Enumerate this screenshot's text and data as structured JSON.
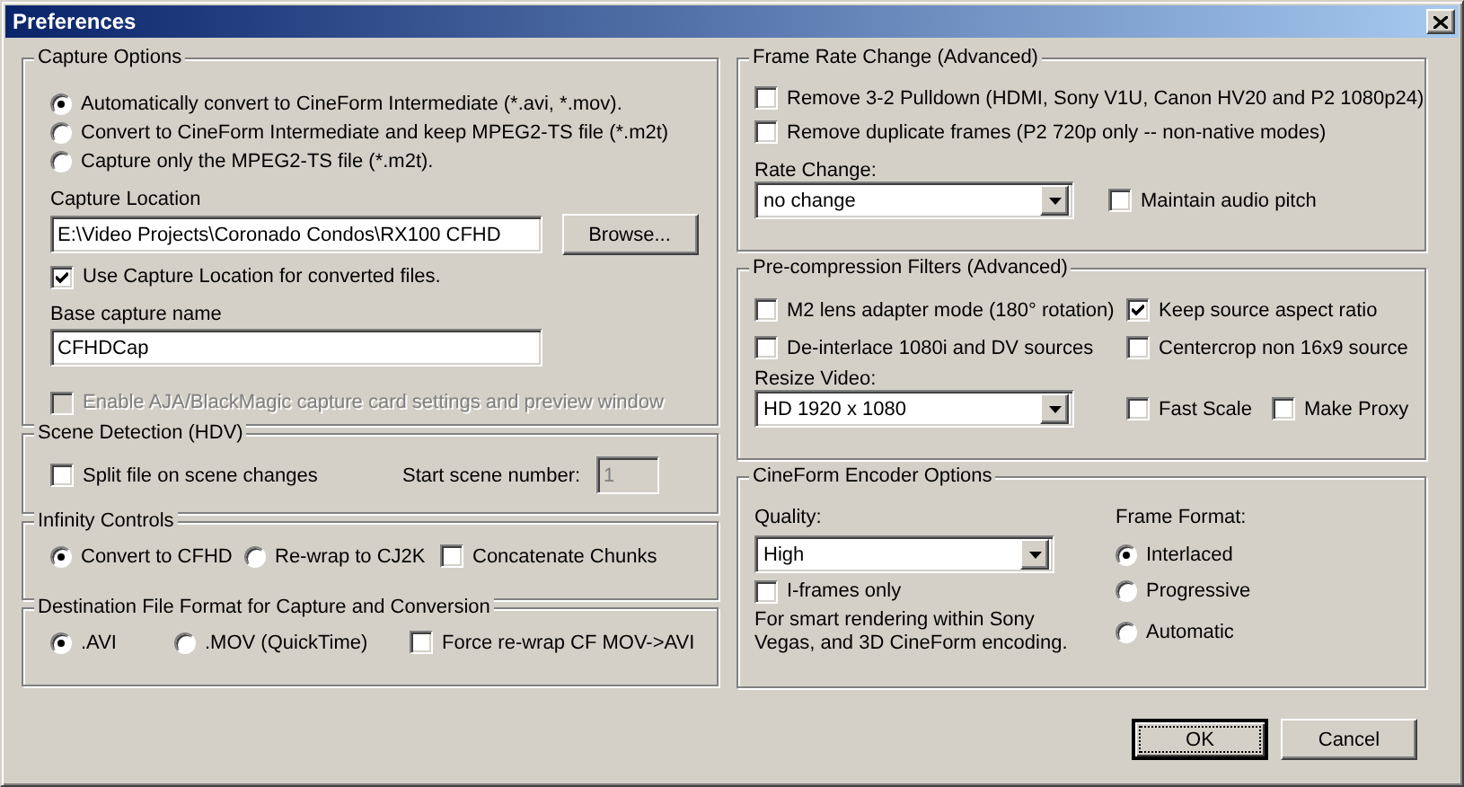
{
  "window": {
    "title": "Preferences"
  },
  "left_panel": {
    "groups": [
      {
        "title": "Capture Options",
        "rows": [
          [
            {
              "kind": "radio",
              "label": "Automatically convert to CineForm Intermediate (*.avi, *.mov).",
              "selected": true
            }
          ],
          [
            {
              "kind": "radio",
              "label": "Convert to CineForm Intermediate and keep MPEG2-TS file (*.m2t)",
              "selected": false
            }
          ],
          [
            {
              "kind": "radio",
              "label": "Capture only the MPEG2-TS file (*.m2t).",
              "selected": false
            }
          ],
          [
            {
              "kind": "label",
              "text": "Capture Location"
            }
          ],
          [
            {
              "kind": "field",
              "value": "E:\\Video Projects\\Coronado Condos\\RX100 CFHD",
              "disabled": false
            },
            {
              "kind": "button",
              "label": "Browse...",
              "default": false
            }
          ],
          [
            {
              "kind": "checkbox",
              "label": "Use Capture Location for converted files.",
              "checked": true,
              "disabled": false
            }
          ],
          [
            {
              "kind": "label",
              "text": "Base capture name"
            }
          ],
          [
            {
              "kind": "field",
              "value": "CFHDCap",
              "disabled": false
            }
          ],
          [
            {
              "kind": "checkbox",
              "label": "Enable AJA/BlackMagic capture card settings and preview window",
              "checked": false,
              "disabled": true
            }
          ]
        ]
      },
      {
        "title": "Scene Detection (HDV)",
        "rows": [
          [
            {
              "kind": "checkbox",
              "label": "Split file on scene changes",
              "checked": false,
              "disabled": false
            },
            {
              "kind": "label",
              "text": "Start scene number:"
            },
            {
              "kind": "field",
              "value": "1",
              "disabled": true
            }
          ]
        ]
      },
      {
        "title": "Infinity Controls",
        "rows": [
          [
            {
              "kind": "radio",
              "label": "Convert to CFHD",
              "selected": true
            },
            {
              "kind": "radio",
              "label": "Re-wrap to CJ2K",
              "selected": false
            },
            {
              "kind": "checkbox",
              "label": "Concatenate Chunks",
              "checked": false,
              "disabled": false
            }
          ]
        ]
      },
      {
        "title": "Destination File Format for Capture and Conversion",
        "rows": [
          [
            {
              "kind": "radio",
              "label": ".AVI",
              "selected": true
            },
            {
              "kind": "radio",
              "label": ".MOV (QuickTime)",
              "selected": false
            },
            {
              "kind": "checkbox",
              "label": "Force re-wrap CF MOV->AVI",
              "checked": false,
              "disabled": false
            }
          ]
        ]
      }
    ]
  },
  "right_panel": {
    "groups": [
      {
        "title": "Frame Rate Change (Advanced)",
        "rows": [
          [
            {
              "kind": "checkbox",
              "label": "Remove 3-2 Pulldown (HDMI, Sony V1U, Canon HV20 and P2 1080p24)",
              "checked": false,
              "disabled": false
            }
          ],
          [
            {
              "kind": "checkbox",
              "label": "Remove duplicate frames (P2 720p only -- non-native modes)",
              "checked": false,
              "disabled": false
            }
          ],
          [
            {
              "kind": "label",
              "text": "Rate Change:"
            }
          ],
          [
            {
              "kind": "combo",
              "value": "no change"
            },
            {
              "kind": "checkbox",
              "label": "Maintain audio pitch",
              "checked": false,
              "disabled": false
            }
          ]
        ]
      },
      {
        "title": "Pre-compression Filters (Advanced)",
        "rows": [
          [
            {
              "kind": "checkbox",
              "label": "M2 lens adapter mode (180° rotation)",
              "checked": false,
              "disabled": false
            },
            {
              "kind": "checkbox",
              "label": "Keep source aspect ratio",
              "checked": true,
              "disabled": false
            }
          ],
          [
            {
              "kind": "checkbox",
              "label": "De-interlace 1080i and DV sources",
              "checked": false,
              "disabled": false
            },
            {
              "kind": "checkbox",
              "label": "Centercrop non 16x9 source",
              "checked": false,
              "disabled": false
            }
          ],
          [
            {
              "kind": "label",
              "text": "Resize Video:"
            }
          ],
          [
            {
              "kind": "combo",
              "value": "HD 1920 x 1080"
            },
            {
              "kind": "checkbox",
              "label": "Fast Scale",
              "checked": false,
              "disabled": false
            },
            {
              "kind": "checkbox",
              "label": "Make Proxy",
              "checked": false,
              "disabled": false
            }
          ]
        ]
      },
      {
        "title": "CineForm Encoder Options",
        "rows": [
          [
            {
              "kind": "label",
              "text": "Quality:"
            },
            {
              "kind": "label",
              "text": "Frame Format:"
            }
          ],
          [
            {
              "kind": "combo",
              "value": "High"
            },
            {
              "kind": "radio",
              "label": "Interlaced",
              "selected": true
            }
          ],
          [
            {
              "kind": "checkbox",
              "label": "I-frames only",
              "checked": false,
              "disabled": false
            },
            {
              "kind": "radio",
              "label": "Progressive",
              "selected": false
            }
          ],
          [
            {
              "kind": "note",
              "text": "For smart rendering within Sony Vegas, and 3D CineForm encoding."
            },
            {
              "kind": "radio",
              "label": "Automatic",
              "selected": false
            }
          ]
        ]
      }
    ]
  },
  "buttons": [
    {
      "label": "OK",
      "default": true
    },
    {
      "label": "Cancel",
      "default": false
    }
  ]
}
